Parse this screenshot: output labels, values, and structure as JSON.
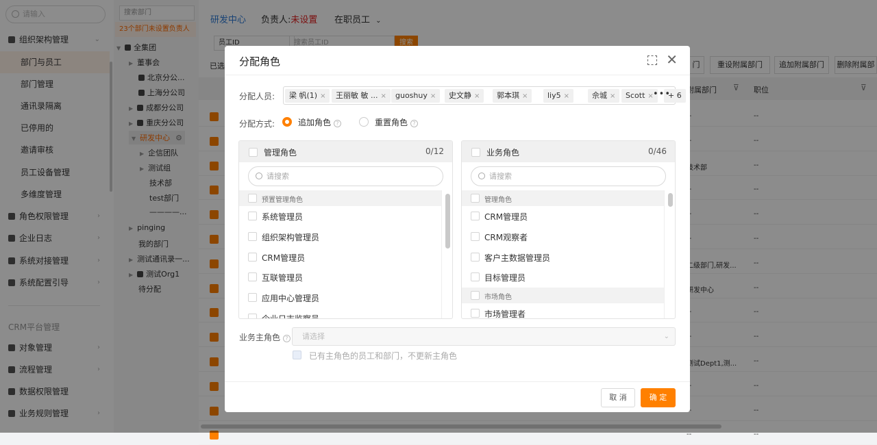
{
  "nav": {
    "search_placeholder": "请输入",
    "items": [
      {
        "label": "组织架构管理",
        "kind": "group",
        "icon": "org-icon"
      },
      {
        "label": "部门与员工",
        "kind": "sub",
        "active": true
      },
      {
        "label": "部门管理",
        "kind": "sub"
      },
      {
        "label": "通讯录隔离",
        "kind": "sub"
      },
      {
        "label": "已停用的",
        "kind": "sub"
      },
      {
        "label": "邀请审核",
        "kind": "sub"
      },
      {
        "label": "员工设备管理",
        "kind": "sub"
      },
      {
        "label": "多维度管理",
        "kind": "sub"
      },
      {
        "label": "角色权限管理",
        "kind": "group",
        "icon": "role-icon"
      },
      {
        "label": "企业日志",
        "kind": "group",
        "icon": "log-icon"
      },
      {
        "label": "系统对接管理",
        "kind": "group",
        "icon": "link-icon"
      },
      {
        "label": "系统配置引导",
        "kind": "group",
        "icon": "config-icon"
      }
    ],
    "section_label": "CRM平台管理",
    "crm_items": [
      {
        "label": "对象管理"
      },
      {
        "label": "流程管理"
      },
      {
        "label": "数据权限管理"
      },
      {
        "label": "业务规则管理"
      }
    ]
  },
  "tree": {
    "search_placeholder": "搜索部门",
    "warning": "23个部门未设置负责人",
    "nodes": [
      {
        "label": "全集团"
      },
      {
        "label": "董事会"
      },
      {
        "label": "北京分公..."
      },
      {
        "label": "上海分公司"
      },
      {
        "label": "成都分公司"
      },
      {
        "label": "重庆分公司"
      },
      {
        "label": "研发中心"
      },
      {
        "label": "企信团队"
      },
      {
        "label": "测试组"
      },
      {
        "label": "技术部"
      },
      {
        "label": "test部门"
      },
      {
        "label": "————..."
      },
      {
        "label": "pinging"
      },
      {
        "label": "我的部门"
      },
      {
        "label": "测试通讯录一..."
      },
      {
        "label": "测试Org1"
      },
      {
        "label": "待分配"
      }
    ]
  },
  "main": {
    "dept_title": "研发中心",
    "owner_label": "负责人:",
    "owner_value": "未设置",
    "status_filter": "在职员工",
    "filter_field": "员工ID",
    "filter_placeholder": "搜索员工ID",
    "search_btn": "搜索",
    "selected_prefix": "已选",
    "action_buttons": [
      "门",
      "重设附属部门",
      "追加附属部门",
      "删除附属部"
    ],
    "col_headers": [
      "附属部门",
      "职位"
    ],
    "rows": [
      "--",
      "--",
      "技术部",
      "--",
      "--",
      "--",
      "二级部门,研发...",
      "研发中心",
      "--",
      "--",
      "测试Dept1,测...",
      "--",
      "--",
      "--"
    ]
  },
  "modal": {
    "title": "分配角色",
    "assignees_label": "分配人员:",
    "assignees": [
      "梁 帆(1)",
      "王丽敏 敏 ...",
      "guoshuy",
      "史文静",
      "郭本琪",
      "liy5",
      "佘城",
      "Scott"
    ],
    "more_count": "+ 6",
    "method_label": "分配方式:",
    "method_options": [
      {
        "label": "追加角色",
        "selected": true
      },
      {
        "label": "重置角色",
        "selected": false
      }
    ],
    "admin_panel": {
      "title": "管理角色",
      "count": "0/12",
      "search_placeholder": "请搜索",
      "rows": [
        {
          "label": "预置管理角色",
          "group": true
        },
        {
          "label": "系统管理员"
        },
        {
          "label": "组织架构管理员"
        },
        {
          "label": "CRM管理员"
        },
        {
          "label": "互联管理员"
        },
        {
          "label": "应用中心管理员"
        },
        {
          "label": "企业日志监察员"
        }
      ]
    },
    "biz_panel": {
      "title": "业务角色",
      "count": "0/46",
      "search_placeholder": "请搜索",
      "rows": [
        {
          "label": "管理角色",
          "group": true
        },
        {
          "label": "CRM管理员"
        },
        {
          "label": "CRM观察者"
        },
        {
          "label": "客户主数据管理员"
        },
        {
          "label": "目标管理员"
        },
        {
          "label": "市场角色",
          "group": true
        },
        {
          "label": "市场管理者"
        }
      ]
    },
    "main_role_label": "业务主角色",
    "main_role_placeholder": "请选择",
    "keep_main_role_text": "已有主角色的员工和部门，不更新主角色",
    "cancel_label": "取 消",
    "ok_label": "确 定"
  },
  "colors": {
    "accent": "#ff8000",
    "dept_title": "#2e7bd6",
    "warning": "#e02020"
  }
}
